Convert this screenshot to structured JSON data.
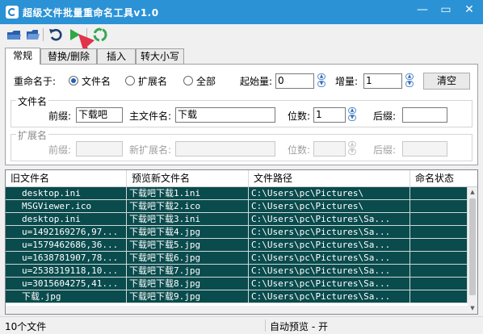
{
  "window": {
    "title": "超级文件批量重命名工具v1.0",
    "minimize": "—",
    "maximize": "▭",
    "close": "✕"
  },
  "toolbar": {
    "buttons": [
      {
        "name": "open-folder-icon"
      },
      {
        "name": "open-file-icon"
      },
      {
        "name": "undo-icon"
      },
      {
        "name": "run-icon"
      },
      {
        "name": "recycle-icon"
      }
    ]
  },
  "tabs": [
    {
      "label": "常规",
      "active": true
    },
    {
      "label": "替换/删除",
      "active": false
    },
    {
      "label": "插入",
      "active": false
    },
    {
      "label": "转大小写",
      "active": false
    }
  ],
  "general": {
    "rename_to_label": "重命名于:",
    "radio_filename": "文件名",
    "radio_ext": "扩展名",
    "radio_all": "全部",
    "start_label": "起始量:",
    "start_value": "0",
    "inc_label": "增量:",
    "inc_value": "1",
    "clear_button": "清空",
    "filename_group": "文件名",
    "prefix_label": "前缀:",
    "prefix_value": "下载吧",
    "main_label": "主文件名:",
    "main_value": "下载",
    "digits_label": "位数:",
    "digits_value": "1",
    "suffix_label": "后缀:",
    "suffix_value": "",
    "ext_group": "扩展名",
    "ext_prefix_label": "前缀:",
    "ext_new_label": "新扩展名:",
    "ext_digits_label": "位数:",
    "ext_suffix_label": "后缀:"
  },
  "table": {
    "headers": [
      "旧文件名",
      "预览新文件名",
      "文件路径",
      "命名状态"
    ],
    "rows": [
      [
        "desktop.ini",
        "下载吧下载1.ini",
        "C:\\Users\\pc\\Pictures\\",
        ""
      ],
      [
        "MSGViewer.ico",
        "下载吧下载2.ico",
        "C:\\Users\\pc\\Pictures\\",
        ""
      ],
      [
        "desktop.ini",
        "下载吧下载3.ini",
        "C:\\Users\\pc\\Pictures\\Sa...",
        ""
      ],
      [
        "u=1492169276,97...",
        "下载吧下载4.jpg",
        "C:\\Users\\pc\\Pictures\\Sa...",
        ""
      ],
      [
        "u=1579462686,36...",
        "下载吧下载5.jpg",
        "C:\\Users\\pc\\Pictures\\Sa...",
        ""
      ],
      [
        "u=1638781907,78...",
        "下载吧下载6.jpg",
        "C:\\Users\\pc\\Pictures\\Sa...",
        ""
      ],
      [
        "u=2538319118,10...",
        "下载吧下载7.jpg",
        "C:\\Users\\pc\\Pictures\\Sa...",
        ""
      ],
      [
        "u=3015604275,41...",
        "下载吧下载8.jpg",
        "C:\\Users\\pc\\Pictures\\Sa...",
        ""
      ],
      [
        "下载.jpg",
        "下载吧下载9.jpg",
        "C:\\Users\\pc\\Pictures\\Sa...",
        ""
      ]
    ]
  },
  "status": {
    "count": "10个文件",
    "preview": "自动预览 - 开"
  },
  "colors": {
    "titlebar": "#2b92d6",
    "row_bg": "#0a4b4d",
    "accent_arrow": "#e0344a"
  }
}
